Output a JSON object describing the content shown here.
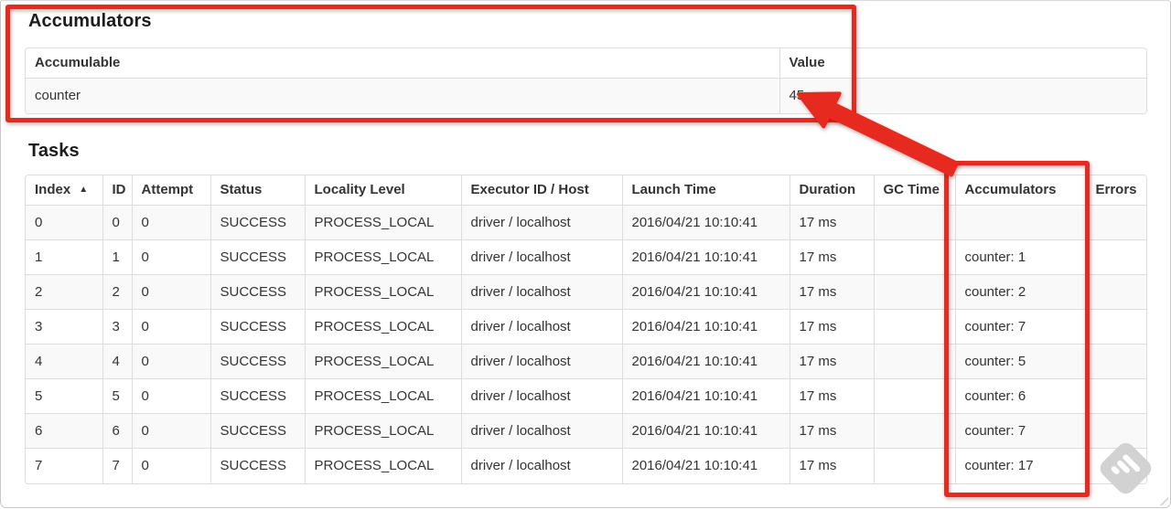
{
  "annotations": {
    "red": "#e62a20",
    "watermark_gray": "#d2d2d2"
  },
  "accumulators_section": {
    "heading": "Accumulators",
    "table": {
      "interactive_headers": false,
      "headers": [
        {
          "label": "Accumulable"
        },
        {
          "label": "Value"
        }
      ],
      "rows": [
        [
          "counter",
          "45"
        ]
      ]
    }
  },
  "tasks_section": {
    "heading": "Tasks",
    "table": {
      "interactive_headers": true,
      "headers": [
        {
          "label": "Index",
          "sort": "▲"
        },
        {
          "label": "ID"
        },
        {
          "label": "Attempt"
        },
        {
          "label": "Status"
        },
        {
          "label": "Locality Level"
        },
        {
          "label": "Executor ID / Host"
        },
        {
          "label": "Launch Time"
        },
        {
          "label": "Duration"
        },
        {
          "label": "GC Time"
        },
        {
          "label": "Accumulators"
        },
        {
          "label": "Errors"
        }
      ],
      "rows": [
        [
          "0",
          "0",
          "0",
          "SUCCESS",
          "PROCESS_LOCAL",
          "driver / localhost",
          "2016/04/21 10:10:41",
          "17 ms",
          "",
          "",
          ""
        ],
        [
          "1",
          "1",
          "0",
          "SUCCESS",
          "PROCESS_LOCAL",
          "driver / localhost",
          "2016/04/21 10:10:41",
          "17 ms",
          "",
          "counter: 1",
          ""
        ],
        [
          "2",
          "2",
          "0",
          "SUCCESS",
          "PROCESS_LOCAL",
          "driver / localhost",
          "2016/04/21 10:10:41",
          "17 ms",
          "",
          "counter: 2",
          ""
        ],
        [
          "3",
          "3",
          "0",
          "SUCCESS",
          "PROCESS_LOCAL",
          "driver / localhost",
          "2016/04/21 10:10:41",
          "17 ms",
          "",
          "counter: 7",
          ""
        ],
        [
          "4",
          "4",
          "0",
          "SUCCESS",
          "PROCESS_LOCAL",
          "driver / localhost",
          "2016/04/21 10:10:41",
          "17 ms",
          "",
          "counter: 5",
          ""
        ],
        [
          "5",
          "5",
          "0",
          "SUCCESS",
          "PROCESS_LOCAL",
          "driver / localhost",
          "2016/04/21 10:10:41",
          "17 ms",
          "",
          "counter: 6",
          ""
        ],
        [
          "6",
          "6",
          "0",
          "SUCCESS",
          "PROCESS_LOCAL",
          "driver / localhost",
          "2016/04/21 10:10:41",
          "17 ms",
          "",
          "counter: 7",
          ""
        ],
        [
          "7",
          "7",
          "0",
          "SUCCESS",
          "PROCESS_LOCAL",
          "driver / localhost",
          "2016/04/21 10:10:41",
          "17 ms",
          "",
          "counter: 17",
          ""
        ]
      ]
    }
  }
}
